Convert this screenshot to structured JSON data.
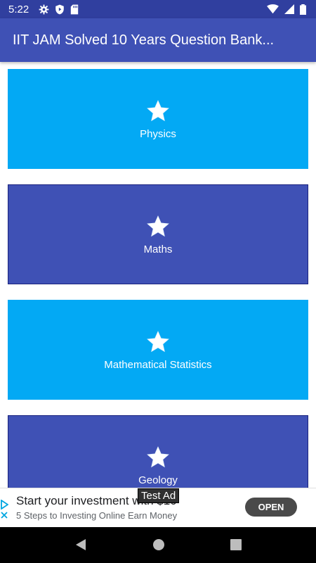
{
  "status_bar": {
    "time": "5:22",
    "icons_left": [
      "settings-icon",
      "shield-icon",
      "sd-card-icon"
    ],
    "icons_right": [
      "wifi-icon",
      "signal-icon",
      "battery-icon"
    ]
  },
  "app_bar": {
    "title": "IIT JAM Solved 10 Years Question Bank..."
  },
  "cards": [
    {
      "label": "Physics",
      "icon": "star-icon",
      "color": "#03a9f4"
    },
    {
      "label": "Maths",
      "icon": "star-icon",
      "color": "#3f51b5"
    },
    {
      "label": "Mathematical Statistics",
      "icon": "star-icon",
      "color": "#03a9f4"
    },
    {
      "label": "Geology",
      "icon": "star-icon",
      "color": "#3f51b5"
    }
  ],
  "ad": {
    "title": "Start your investment with $10",
    "subtitle": "5 Steps to Investing Online Earn Money",
    "cta": "OPEN",
    "tag": "Test Ad"
  },
  "nav_bar": {
    "icons": [
      "back-icon",
      "home-icon",
      "recents-icon"
    ]
  },
  "colors": {
    "status_bar": "#303f9f",
    "app_bar": "#3f51b5",
    "card_light": "#03a9f4",
    "card_dark": "#3f51b5"
  }
}
